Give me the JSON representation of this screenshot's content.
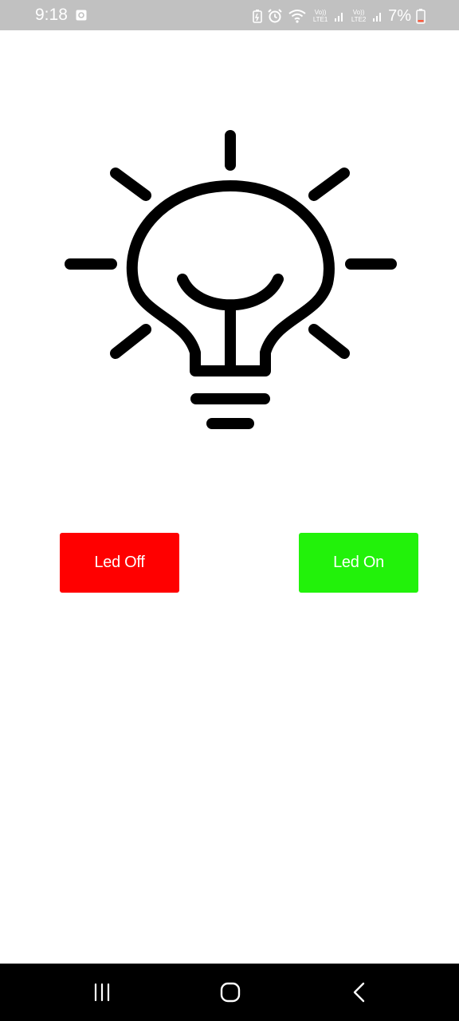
{
  "status_bar": {
    "time": "9:18",
    "sim1_label": "Vo)) LTE1",
    "sim2_label": "Vo)) LTE2",
    "battery": "7%",
    "icons": [
      "gallery-icon",
      "battery-saver-icon",
      "alarm-icon",
      "wifi-icon",
      "signal-icon",
      "signal-icon",
      "battery-icon"
    ]
  },
  "main": {
    "illustration": "lightbulb-icon",
    "buttons": {
      "off_label": "Led Off",
      "on_label": "Led On"
    }
  },
  "colors": {
    "status_bar_bg": "#c1c1c1",
    "off_button": "#ff0000",
    "on_button": "#22f20a",
    "nav_bar_bg": "#000000",
    "battery_low": "#ff5a3c"
  },
  "nav_bar": {
    "icons": [
      "recents-icon",
      "home-icon",
      "back-icon"
    ]
  }
}
